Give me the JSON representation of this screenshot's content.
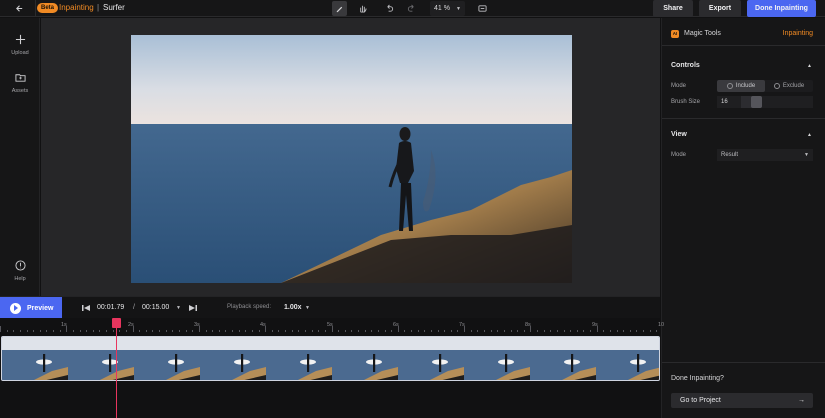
{
  "header": {
    "back_icon": "arrow-left-icon",
    "badge": "Beta",
    "mode": "Inpainting",
    "separator": "|",
    "project_name": "Surfer",
    "tools": [
      {
        "name": "brush-icon",
        "active": true
      },
      {
        "name": "hand-icon",
        "active": false
      },
      {
        "name": "undo-icon",
        "active": false
      },
      {
        "name": "redo-icon",
        "active": false
      }
    ],
    "zoom": "41 %",
    "screen_icon": "monitor-icon",
    "share_label": "Share",
    "export_label": "Export",
    "done_label": "Done Inpainting"
  },
  "sidebar": {
    "upload_label": "Upload",
    "assets_label": "Assets",
    "help_label": "Help"
  },
  "panel": {
    "ai_badge": "AI",
    "title": "Magic Tools",
    "mode_tag": "Inpainting",
    "controls_title": "Controls",
    "mode_label": "Mode",
    "include_label": "Include",
    "exclude_label": "Exclude",
    "brush_label": "Brush Size",
    "brush_value": "16",
    "brush_fraction": 0.17,
    "view_title": "View",
    "view_mode_label": "Mode",
    "view_mode_value": "Result",
    "done_question": "Done Inpainting?",
    "go_to_project": "Go to Project",
    "accent": "#f08a24"
  },
  "timeline": {
    "preview_label": "Preview",
    "current_time": "00:01.79",
    "time_separator": "/",
    "total_time": "00:15.00",
    "playback_label": "Playback speed:",
    "playback_value": "1.00x",
    "ruler_labels": [
      "1s",
      "2s",
      "3s",
      "4s",
      "5s",
      "6s",
      "7s",
      "8s",
      "9s",
      "10"
    ],
    "playhead_color": "#e8355e"
  }
}
